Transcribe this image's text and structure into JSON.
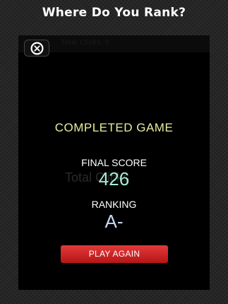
{
  "header": {
    "title": "Where Do You Rank?"
  },
  "overlay": {
    "top_bar_ghost_text": "Total Clicks: 0",
    "ghost_text": "Total Clicks",
    "close_icon": "close-circle-x-icon",
    "completed_label": "COMPLETED GAME",
    "final_score_label": "FINAL SCORE",
    "final_score": "426",
    "ranking_label": "RANKING",
    "ranking_value": "A-",
    "play_again_label": "PLAY AGAIN"
  },
  "colors": {
    "background": "#262626",
    "panel": "#000000",
    "completed_text": "#e8ec9c",
    "score_text": "#a6f0d7",
    "grade_text": "#c7d9f7",
    "button_red": "#cc2222"
  }
}
